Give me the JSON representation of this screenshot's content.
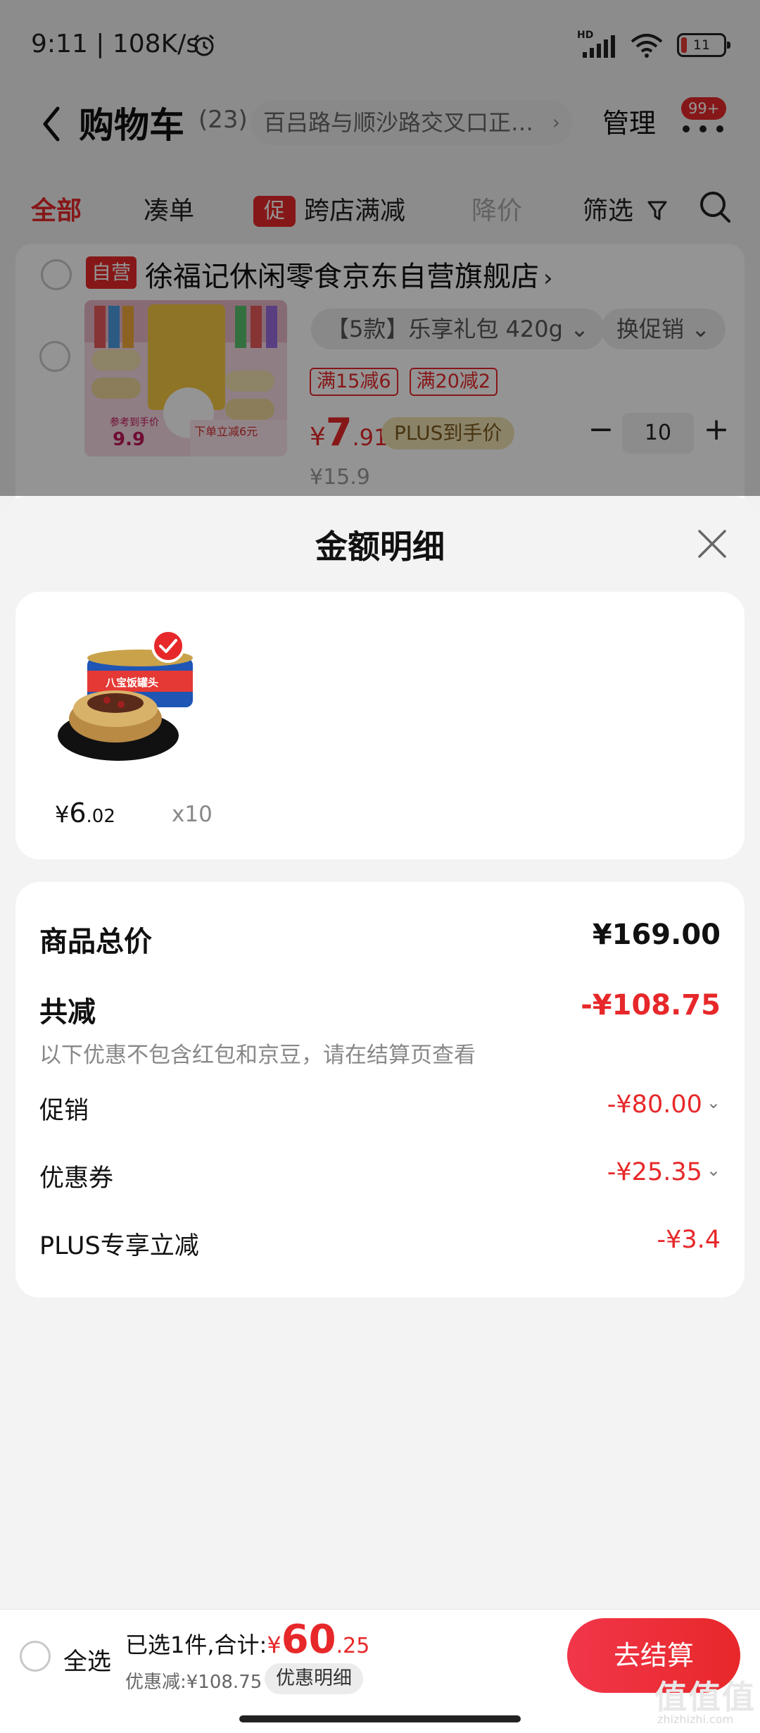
{
  "status_bar": {
    "time": "9:11 | 108K/s",
    "battery": "11",
    "colors": {
      "battery_low": "#e53935"
    }
  },
  "header": {
    "title": "购物车",
    "count": "(23)",
    "address": "百吕路与顺沙路交叉口正…",
    "manage": "管理",
    "badge": "99+"
  },
  "tabs": {
    "all": "全部",
    "combine": "凑单",
    "promo_tag": "促",
    "cross_store": "跨店满减",
    "price_drop": "降价",
    "filter": "筛选"
  },
  "store": {
    "self_operated_tag": "自营",
    "name": "徐福记休闲零食京东自营旗舰店",
    "item": {
      "variant": "【5款】乐享礼包 420g",
      "swap_promo": "换促销",
      "discount_tags": [
        "满15减6",
        "满20减2"
      ],
      "price_symbol": "¥",
      "price_int": "7",
      "price_dec": ".91",
      "plus_label": "PLUS到手价",
      "quantity": "10",
      "original_price": "¥15.9",
      "thumb_text_1": "参考到手价",
      "thumb_text_2": "9.9",
      "thumb_text_3": "下单立减6元"
    }
  },
  "sheet": {
    "title": "金额明细",
    "item": {
      "price_symbol": "¥",
      "price_int": "6",
      "price_dec": ".02",
      "qty": "x10",
      "can_label": "八宝饭罐头"
    },
    "summary": {
      "total_label": "商品总价",
      "total_value": "¥169.00",
      "reduce_label": "共减",
      "reduce_value": "-¥108.75",
      "reduce_note": "以下优惠不包含红包和京豆，请在结算页查看",
      "promo_label": "促销",
      "promo_value": "-¥80.00",
      "coupon_label": "优惠券",
      "coupon_value": "-¥25.35",
      "plus_label": "PLUS专享立减",
      "plus_value": "-¥3.4"
    }
  },
  "bottom_bar": {
    "select_all": "全选",
    "selected_text": "已选1件,合计:",
    "total_symbol": "¥",
    "total_int": "60",
    "total_dec": ".25",
    "saved": "优惠减:¥108.75",
    "detail_button": "优惠明细",
    "checkout": "去结算",
    "watermark": "值值值",
    "watermark_sub": "zhizhizhi.com"
  },
  "colors": {
    "accent": "#e7282a",
    "plus_gold": "#f0e2b3",
    "check_red": "#e7282a"
  },
  "icons": [
    "alarm-icon",
    "signal-icon",
    "wifi-icon",
    "battery-icon",
    "back-icon",
    "more-icon",
    "filter-icon",
    "search-icon",
    "close-icon",
    "check-icon"
  ]
}
